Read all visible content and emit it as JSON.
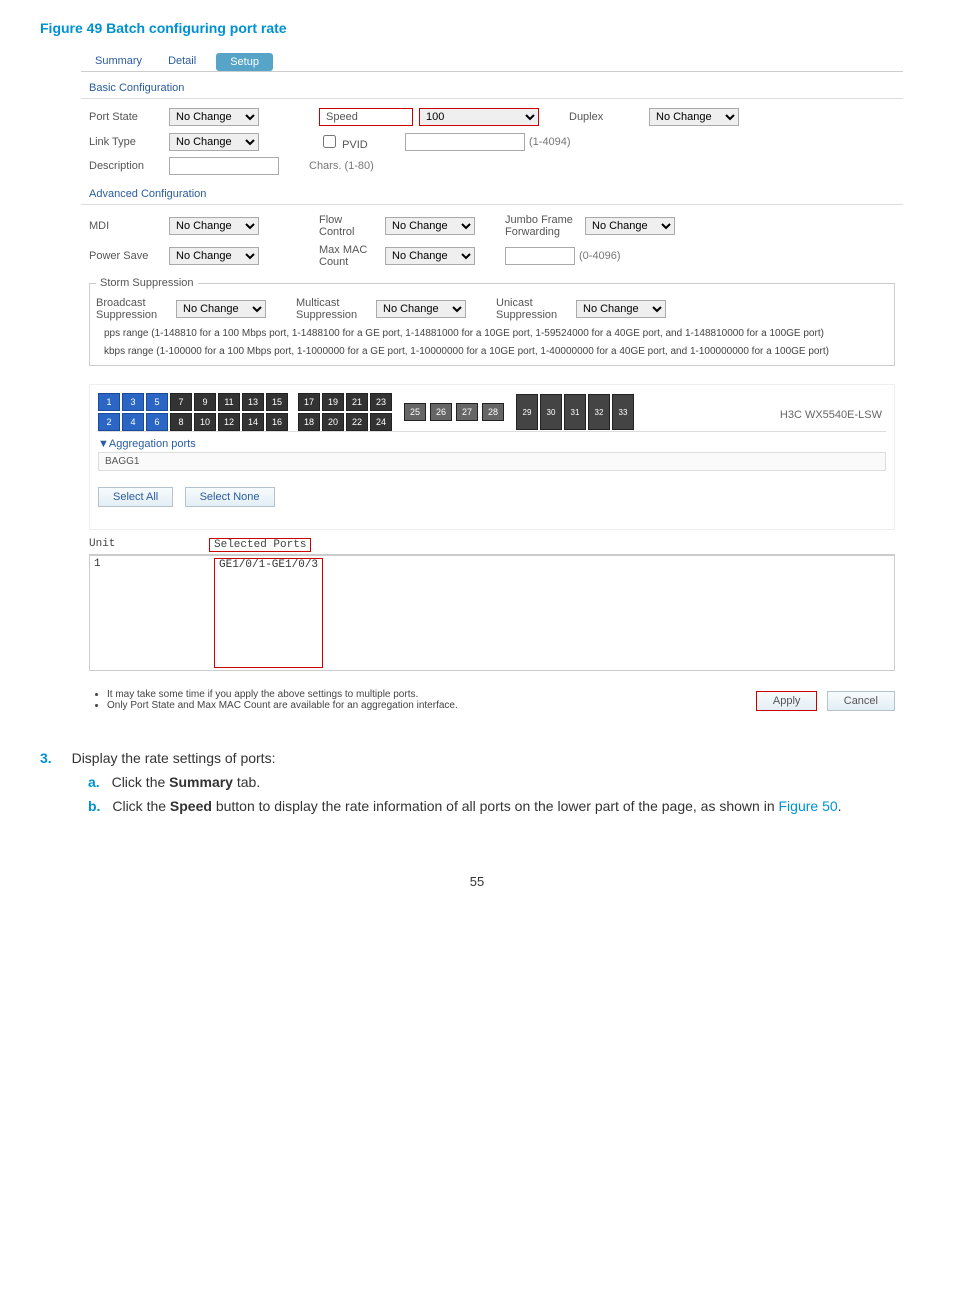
{
  "figure_title": "Figure 49 Batch configuring port rate",
  "tabs": {
    "summary": "Summary",
    "detail": "Detail",
    "setup": "Setup"
  },
  "sections": {
    "basic": "Basic Configuration",
    "advanced": "Advanced Configuration"
  },
  "basic": {
    "port_state_lbl": "Port State",
    "port_state_val": "No Change",
    "speed_lbl": "Speed",
    "speed_val": "100",
    "duplex_lbl": "Duplex",
    "duplex_val": "No Change",
    "link_type_lbl": "Link Type",
    "link_type_val": "No Change",
    "pvid_lbl": "PVID",
    "pvid_hint": "(1-4094)",
    "desc_lbl": "Description",
    "desc_hint": "Chars. (1-80)"
  },
  "adv": {
    "mdi_lbl": "MDI",
    "mdi_val": "No Change",
    "flow_lbl": "Flow Control",
    "flow_val": "No Change",
    "jumbo_lbl": "Jumbo Frame Forwarding",
    "jumbo_val": "No Change",
    "power_lbl": "Power Save",
    "power_val": "No Change",
    "maxmac_lbl": "Max MAC Count",
    "maxmac_val": "No Change",
    "maxmac_hint": "(0-4096)"
  },
  "storm": {
    "legend": "Storm Suppression",
    "bcast_lbl": "Broadcast Suppression",
    "bcast_val": "No Change",
    "mcast_lbl": "Multicast Suppression",
    "mcast_val": "No Change",
    "ucast_lbl": "Unicast Suppression",
    "ucast_val": "No Change",
    "pps_note": "pps range (1-148810 for a 100 Mbps port, 1-1488100 for a GE port, 1-14881000 for a 10GE port, 1-59524000 for a 40GE port, and 1-148810000 for a 100GE port)",
    "kbps_note": "kbps range (1-100000 for a 100 Mbps port, 1-1000000 for a GE port, 1-10000000 for a 10GE port, 1-40000000 for a 40GE port, and 1-100000000 for a 100GE port)"
  },
  "ports": {
    "model": "H3C WX5540E-LSW",
    "top": [
      "1",
      "3",
      "5",
      "7",
      "9",
      "11",
      "13",
      "15",
      "17",
      "19",
      "21",
      "23"
    ],
    "bottom": [
      "2",
      "4",
      "6",
      "8",
      "10",
      "12",
      "14",
      "16",
      "18",
      "20",
      "22",
      "24"
    ],
    "sfp_top": [
      "25",
      "26",
      "27",
      "28"
    ],
    "extra": [
      "29",
      "30",
      "31",
      "32",
      "33"
    ],
    "agg_header": "▼Aggregation ports",
    "agg_item": "BAGG1"
  },
  "sel_buttons": {
    "all": "Select All",
    "none": "Select None"
  },
  "selected": {
    "unit_hdr": "Unit",
    "ports_hdr": "Selected Ports",
    "unit_val": "1",
    "ports_val": "GE1/0/1-GE1/0/3"
  },
  "notes": {
    "n1": "It may take some time if you apply the above settings to multiple ports.",
    "n2": "Only Port State and Max MAC Count are available for an aggregation interface."
  },
  "buttons": {
    "apply": "Apply",
    "cancel": "Cancel"
  },
  "instr": {
    "num": "3.",
    "main": "Display the rate settings of ports:",
    "a_l": "a.",
    "a_t_pre": "Click the ",
    "a_t_bold": "Summary",
    "a_t_post": " tab.",
    "b_l": "b.",
    "b_t_pre": "Click the ",
    "b_t_bold": "Speed",
    "b_t_mid": " button to display the rate information of all ports on the lower part of the page, as shown in ",
    "b_link": "Figure 50",
    "b_t_end": "."
  },
  "page": "55"
}
